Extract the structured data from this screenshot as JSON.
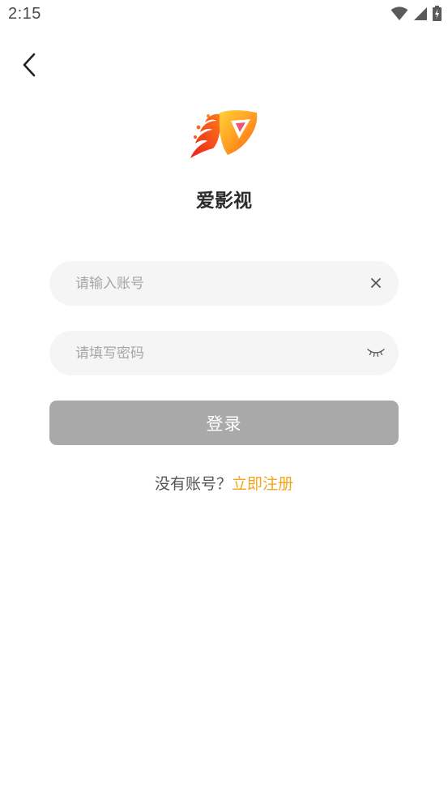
{
  "status_bar": {
    "time": "2:15",
    "icons": [
      "wifi-icon",
      "signal-icon",
      "battery-charging-icon"
    ]
  },
  "nav": {
    "back_icon": "chevron-left-icon"
  },
  "app": {
    "name": "爱影视",
    "logo_icon": "flaming-play-logo"
  },
  "form": {
    "account": {
      "value": "",
      "placeholder": "请输入账号",
      "clear_icon": "close-icon"
    },
    "password": {
      "value": "",
      "placeholder": "请填写密码",
      "toggle_icon": "eye-closed-icon"
    },
    "login_label": "登录"
  },
  "register": {
    "prompt": "没有账号？",
    "link_label": "立即注册"
  },
  "colors": {
    "accent": "#f4a41b",
    "login_button_disabled": "#a9a9a9",
    "field_bg": "#f5f5f5"
  }
}
